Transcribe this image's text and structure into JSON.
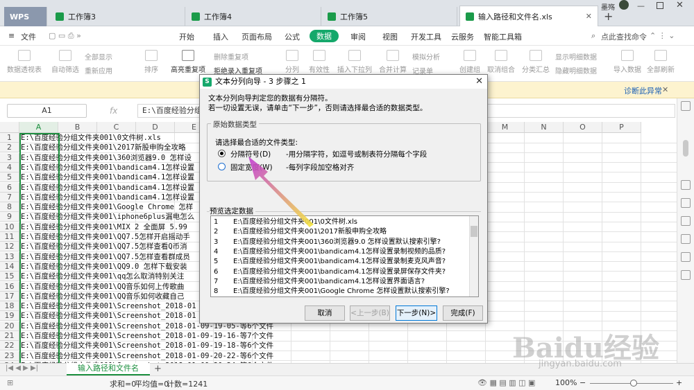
{
  "window": {
    "wps_tab": "WPS",
    "tabs": [
      "工作簿3",
      "工作簿4",
      "工作簿5",
      "输入路径和文件名.xls"
    ],
    "user": "墨殇",
    "new_tab": "+"
  },
  "menu": {
    "file": "文件",
    "items": [
      "开始",
      "插入",
      "页面布局",
      "公式",
      "数据",
      "审阅",
      "视图",
      "开发工具",
      "云服务",
      "智能工具箱"
    ],
    "active": "数据",
    "search": "点此查找命令"
  },
  "ribbon": {
    "items": [
      "数据透视表",
      "自动筛选",
      "全部显示",
      "重新应用",
      "排序",
      "高亮重复项",
      "删除重复项",
      "拒绝录入重复项",
      "分列",
      "有效性",
      "插入下拉列表",
      "合并计算",
      "模拟分析",
      "记录单",
      "创建组",
      "取消组合",
      "分类汇总",
      "显示明细数据",
      "隐藏明细数据",
      "导入数据",
      "全部刷新"
    ]
  },
  "notice": {
    "link": "诊断此异常",
    "close": "✕"
  },
  "formula": {
    "namebox": "A1",
    "fx": "fx",
    "content": "E:\\百度经验分组文件夹001\\0文件树.xls"
  },
  "grid": {
    "columns": [
      "A",
      "B",
      "C",
      "D",
      "E",
      "F",
      "G",
      "H",
      "I",
      "J",
      "K",
      "L",
      "M",
      "N",
      "O",
      "P"
    ],
    "rows": [
      {
        "n": "1",
        "v": "E:\\百度经验分组文件夹001\\0文件树.xls"
      },
      {
        "n": "2",
        "v": "E:\\百度经验分组文件夹001\\2017新股申购全攻略"
      },
      {
        "n": "3",
        "v": "E:\\百度经验分组文件夹001\\360浏览器9.0 怎样设"
      },
      {
        "n": "4",
        "v": "E:\\百度经验分组文件夹001\\bandicam4.1怎样设置"
      },
      {
        "n": "5",
        "v": "E:\\百度经验分组文件夹001\\bandicam4.1怎样设置"
      },
      {
        "n": "6",
        "v": "E:\\百度经验分组文件夹001\\bandicam4.1怎样设置"
      },
      {
        "n": "7",
        "v": "E:\\百度经验分组文件夹001\\bandicam4.1怎样设置"
      },
      {
        "n": "8",
        "v": "E:\\百度经验分组文件夹001\\Google Chrome 怎样"
      },
      {
        "n": "9",
        "v": "E:\\百度经验分组文件夹001\\iphone6plus漏电怎么"
      },
      {
        "n": "10",
        "v": "E:\\百度经验分组文件夹001\\MIX 2 全面屏 5.99"
      },
      {
        "n": "11",
        "v": "E:\\百度经验分组文件夹001\\QQ7.5怎样开启摇动手"
      },
      {
        "n": "12",
        "v": "E:\\百度经验分组文件夹001\\QQ7.5怎样查看Q币消"
      },
      {
        "n": "13",
        "v": "E:\\百度经验分组文件夹001\\QQ7.5怎样查看群成员"
      },
      {
        "n": "14",
        "v": "E:\\百度经验分组文件夹001\\QQ9.0 怎样下载安装"
      },
      {
        "n": "15",
        "v": "E:\\百度经验分组文件夹001\\qq怎么取消特别关注"
      },
      {
        "n": "16",
        "v": "E:\\百度经验分组文件夹001\\QQ音乐如何上传歌曲"
      },
      {
        "n": "17",
        "v": "E:\\百度经验分组文件夹001\\QQ音乐如何收藏自己"
      },
      {
        "n": "18",
        "v": "E:\\百度经验分组文件夹001\\Screenshot_2018-01"
      },
      {
        "n": "19",
        "v": "E:\\百度经验分组文件夹001\\Screenshot_2018-01"
      },
      {
        "n": "20",
        "v": "E:\\百度经验分组文件夹001\\Screenshot_2018-01-09-19-05-等6个文件"
      },
      {
        "n": "21",
        "v": "E:\\百度经验分组文件夹001\\Screenshot_2018-01-09-19-16-等7个文件"
      },
      {
        "n": "22",
        "v": "E:\\百度经验分组文件夹001\\Screenshot_2018-01-09-19-18-等6个文件"
      },
      {
        "n": "23",
        "v": "E:\\百度经验分组文件夹001\\Screenshot_2018-01-09-20-22-等6个文件"
      },
      {
        "n": "24",
        "v": "E:\\百度经验分组文件夹001\\Screenshot_2018-01-09-20-24-等6个文件"
      }
    ]
  },
  "sheet": {
    "tab": "输入路径和文件名",
    "add": "+"
  },
  "status": {
    "sum": "求和=0",
    "avg": "平均值=0",
    "count": "计数=1241",
    "zoom": "100%"
  },
  "dialog": {
    "title": "文本分列向导 - 3 步骤之 1",
    "close": "✕",
    "line1": "文本分列向导判定您的数据有分隔符。",
    "line2": "若一切设置无误，请单击“下一步”，否则请选择最合适的数据类型。",
    "group_title": "原始数据类型",
    "choose_label": "请选择最合适的文件类型:",
    "opt1_label": "分隔符号(D)",
    "opt1_desc": "-用分隔字符，如逗号或制表符分隔每个字段",
    "opt2_label": "固定宽度(W)",
    "opt2_desc": "-每列字段加空格对齐",
    "preview_title": "预览选定数据",
    "preview": [
      {
        "n": "1",
        "t": "E:\\百度经验分组文件夹001\\0文件树.xls"
      },
      {
        "n": "2",
        "t": "E:\\百度经验分组文件夹001\\2017新股申购全攻略"
      },
      {
        "n": "3",
        "t": "E:\\百度经验分组文件夹001\\360浏览器9.0 怎样设置默认搜索引擎?"
      },
      {
        "n": "4",
        "t": "E:\\百度经验分组文件夹001\\bandicam4.1怎样设置录制视频的品质?"
      },
      {
        "n": "5",
        "t": "E:\\百度经验分组文件夹001\\bandicam4.1怎样设置录制麦克风声音?"
      },
      {
        "n": "6",
        "t": "E:\\百度经验分组文件夹001\\bandicam4.1怎样设置录屏保存文件夹?"
      },
      {
        "n": "7",
        "t": "E:\\百度经验分组文件夹001\\bandicam4.1怎样设置界面语言?"
      },
      {
        "n": "8",
        "t": "E:\\百度经验分组文件夹001\\Google Chrome 怎样设置默认搜索引擎?"
      },
      {
        "n": "9",
        "t": "E:\\百度经验分组文件夹001\\iphone6plus漏电怎么样"
      }
    ],
    "btn_cancel": "取消",
    "btn_prev": "<上一步(B)",
    "btn_next": "下一步(N)>",
    "btn_finish": "完成(F)"
  },
  "watermark": {
    "brand": "Baidu经验",
    "url": "jingyan.baidu.com"
  },
  "colors": {
    "accent": "#15a86b",
    "selection": "#1b8f3e",
    "arrow_start": "#f5e93a",
    "arrow_end": "#c23bd4"
  }
}
